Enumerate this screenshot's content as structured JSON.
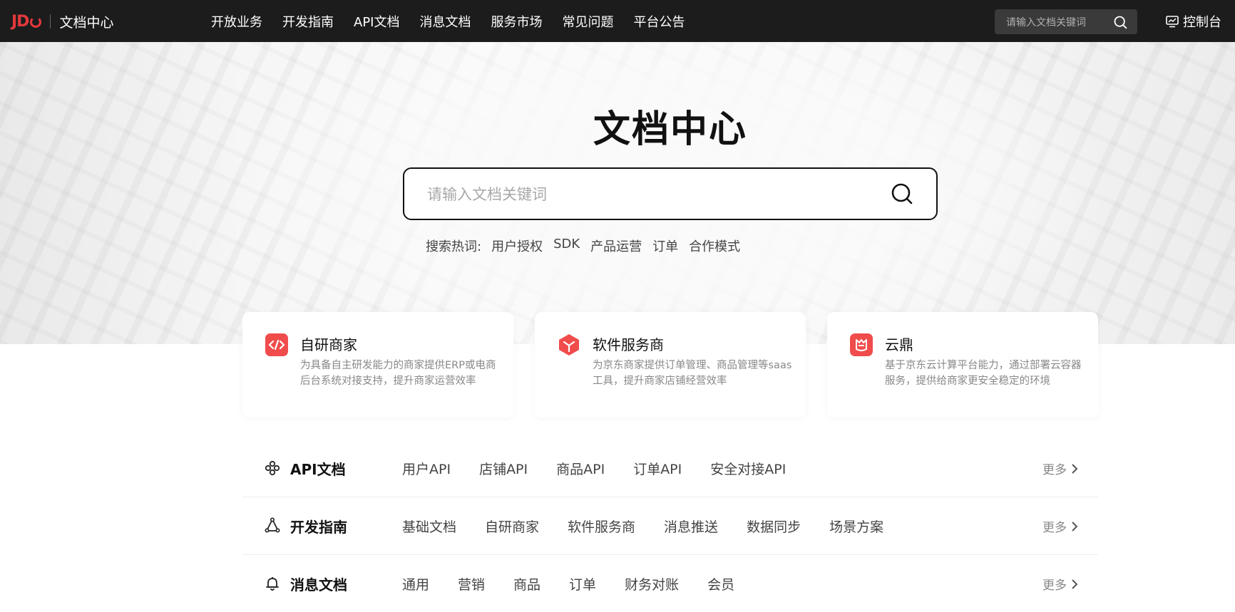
{
  "header": {
    "logo_mark": "JD",
    "logo_text": "文档中心",
    "nav": [
      "开放业务",
      "开发指南",
      "API文档",
      "消息文档",
      "服务市场",
      "常见问题",
      "平台公告"
    ],
    "search_placeholder": "请输入文档关键词",
    "console_label": "控制台"
  },
  "hero": {
    "title": "文档中心",
    "search_placeholder": "请输入文档关键词",
    "hot_label": "搜索热词:",
    "hot_keywords": [
      "用户授权",
      "SDK",
      "产品运营",
      "订单",
      "合作模式"
    ]
  },
  "cards": [
    {
      "title": "自研商家",
      "desc": "为具备自主研发能力的商家提供ERP或电商后台系统对接支持，提升商家运营效率",
      "icon": "code-icon"
    },
    {
      "title": "软件服务商",
      "desc": "为京东商家提供订单管理、商品管理等saas工具，提升商家店铺经营效率",
      "icon": "cube-icon"
    },
    {
      "title": "云鼎",
      "desc": "基于京东云计算平台能力，通过部署云容器服务，提供给商家更安全稳定的环境",
      "icon": "cloud-tripod-icon"
    }
  ],
  "sections": [
    {
      "title": "API文档",
      "icon": "api-icon",
      "links": [
        "用户API",
        "店铺API",
        "商品API",
        "订单API",
        "安全对接API"
      ],
      "more": "更多"
    },
    {
      "title": "开发指南",
      "icon": "guide-icon",
      "links": [
        "基础文档",
        "自研商家",
        "软件服务商",
        "消息推送",
        "数据同步",
        "场景方案"
      ],
      "more": "更多"
    },
    {
      "title": "消息文档",
      "icon": "bell-icon",
      "links": [
        "通用",
        "营销",
        "商品",
        "订单",
        "财务对账",
        "会员"
      ],
      "more": "更多"
    }
  ],
  "colors": {
    "topbar": "#1c1c1c",
    "brand_red": "#e4393c",
    "card_icon_red": "#f04c4c"
  }
}
